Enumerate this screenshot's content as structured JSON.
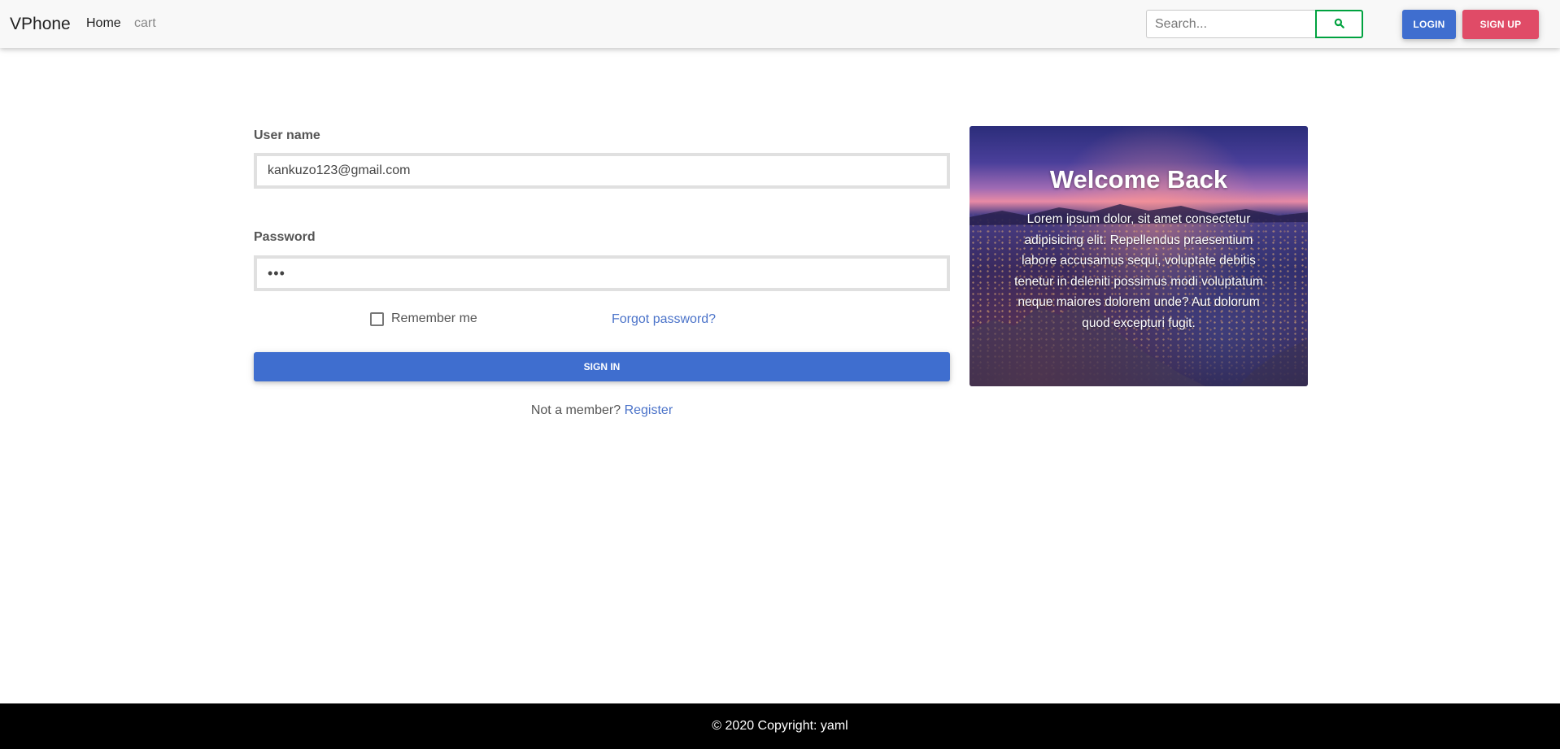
{
  "navbar": {
    "brand": "VPhone",
    "links": [
      {
        "label": "Home"
      },
      {
        "label": "cart"
      }
    ],
    "search": {
      "placeholder": "Search...",
      "value": ""
    },
    "login_label": "LOGIN",
    "signup_label": "SIGN UP",
    "colors": {
      "primary": "#3f6ecf",
      "danger": "#e04b67",
      "search_button_border": "#00a23f"
    },
    "icons": {
      "search": "search-icon"
    }
  },
  "form": {
    "username_label": "User name",
    "username_value": "kankuzo123@gmail.com",
    "password_label": "Password",
    "password_value": "abc",
    "remember_label": "Remember me",
    "remember_checked": false,
    "forgot_label": "Forgot password?",
    "signin_label": "SIGN IN",
    "member_text": "Not a member?",
    "register_label": "Register"
  },
  "card": {
    "title": "Welcome Back",
    "text": "Lorem ipsum dolor, sit amet consectetur adipisicing elit. Repellendus praesentium labore accusamus sequi, voluptate debitis tenetur in deleniti possimus modi voluptatum neque maiores dolorem unde? Aut dolorum quod excepturi fugit."
  },
  "footer": {
    "text": "© 2020 Copyright: yaml"
  }
}
